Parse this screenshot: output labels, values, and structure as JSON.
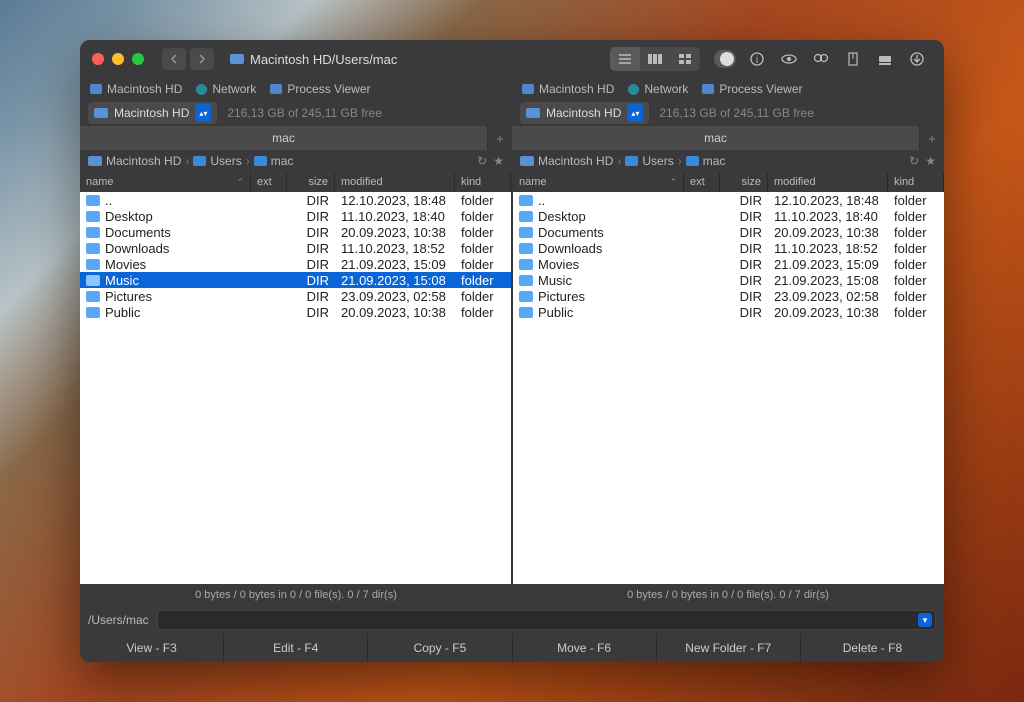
{
  "title": "Macintosh HD/Users/mac",
  "favorites": [
    {
      "label": "Macintosh HD",
      "icon": "disk"
    },
    {
      "label": "Network",
      "icon": "globe"
    },
    {
      "label": "Process Viewer",
      "icon": "monitor"
    }
  ],
  "volume": {
    "name": "Macintosh HD",
    "free": "216,13 GB of 245,11 GB free"
  },
  "tab_label": "mac",
  "breadcrumb": [
    {
      "label": "Macintosh HD",
      "icon": "disk"
    },
    {
      "label": "Users",
      "icon": "folder"
    },
    {
      "label": "mac",
      "icon": "folder"
    }
  ],
  "columns": {
    "name": "name",
    "ext": "ext",
    "size": "size",
    "modified": "modified",
    "kind": "kind"
  },
  "left": {
    "selected_index": 5,
    "files": [
      {
        "name": "..",
        "ext": "",
        "size": "DIR",
        "modified": "12.10.2023, 18:48",
        "kind": "folder"
      },
      {
        "name": "Desktop",
        "ext": "",
        "size": "DIR",
        "modified": "11.10.2023, 18:40",
        "kind": "folder"
      },
      {
        "name": "Documents",
        "ext": "",
        "size": "DIR",
        "modified": "20.09.2023, 10:38",
        "kind": "folder"
      },
      {
        "name": "Downloads",
        "ext": "",
        "size": "DIR",
        "modified": "11.10.2023, 18:52",
        "kind": "folder"
      },
      {
        "name": "Movies",
        "ext": "",
        "size": "DIR",
        "modified": "21.09.2023, 15:09",
        "kind": "folder"
      },
      {
        "name": "Music",
        "ext": "",
        "size": "DIR",
        "modified": "21.09.2023, 15:08",
        "kind": "folder"
      },
      {
        "name": "Pictures",
        "ext": "",
        "size": "DIR",
        "modified": "23.09.2023, 02:58",
        "kind": "folder"
      },
      {
        "name": "Public",
        "ext": "",
        "size": "DIR",
        "modified": "20.09.2023, 10:38",
        "kind": "folder"
      }
    ],
    "status": "0 bytes / 0 bytes in 0 / 0 file(s). 0 / 7 dir(s)"
  },
  "right": {
    "selected_index": -1,
    "files": [
      {
        "name": "..",
        "ext": "",
        "size": "DIR",
        "modified": "12.10.2023, 18:48",
        "kind": "folder"
      },
      {
        "name": "Desktop",
        "ext": "",
        "size": "DIR",
        "modified": "11.10.2023, 18:40",
        "kind": "folder"
      },
      {
        "name": "Documents",
        "ext": "",
        "size": "DIR",
        "modified": "20.09.2023, 10:38",
        "kind": "folder"
      },
      {
        "name": "Downloads",
        "ext": "",
        "size": "DIR",
        "modified": "11.10.2023, 18:52",
        "kind": "folder"
      },
      {
        "name": "Movies",
        "ext": "",
        "size": "DIR",
        "modified": "21.09.2023, 15:09",
        "kind": "folder"
      },
      {
        "name": "Music",
        "ext": "",
        "size": "DIR",
        "modified": "21.09.2023, 15:08",
        "kind": "folder"
      },
      {
        "name": "Pictures",
        "ext": "",
        "size": "DIR",
        "modified": "23.09.2023, 02:58",
        "kind": "folder"
      },
      {
        "name": "Public",
        "ext": "",
        "size": "DIR",
        "modified": "20.09.2023, 10:38",
        "kind": "folder"
      }
    ],
    "status": "0 bytes / 0 bytes in 0 / 0 file(s). 0 / 7 dir(s)"
  },
  "cmd_path": "/Users/mac",
  "fn_buttons": [
    "View - F3",
    "Edit - F4",
    "Copy - F5",
    "Move - F6",
    "New Folder - F7",
    "Delete - F8"
  ]
}
